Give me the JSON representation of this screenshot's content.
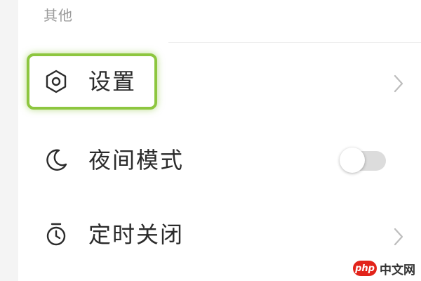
{
  "section": {
    "title": "其他"
  },
  "items": [
    {
      "label": "设置",
      "icon": "hexagon-settings-icon",
      "trailing": "chevron"
    },
    {
      "label": "夜间模式",
      "icon": "moon-icon",
      "trailing": "toggle",
      "toggle_on": false
    },
    {
      "label": "定时关闭",
      "icon": "timer-icon",
      "trailing": "chevron"
    }
  ],
  "highlight": {
    "target": "设置",
    "color": "#8dc63f"
  },
  "watermark": {
    "badge": "php",
    "text": "中文网"
  },
  "colors": {
    "text": "#2b2b2b",
    "section_title": "#9a9a9a",
    "toggle_track": "#dcdcdc"
  }
}
